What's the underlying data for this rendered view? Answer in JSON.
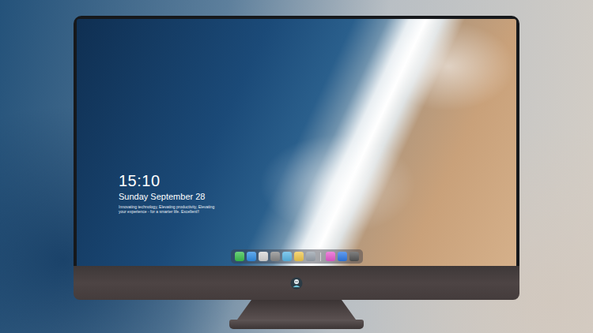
{
  "screen": {
    "clock": "15:10",
    "date": "Sunday September 28",
    "tagline": [
      "Innovating technology, Elevating productivity, Elevating",
      "your experience - for a smarter life. Excellent!!"
    ]
  },
  "dock": {
    "items": [
      {
        "kind": "app",
        "color": "#3cc24e"
      },
      {
        "kind": "app",
        "color": "#2f8fe8"
      },
      {
        "kind": "app",
        "color": "#d8d8d8"
      },
      {
        "kind": "app",
        "color": "#8a8a8a"
      },
      {
        "kind": "app",
        "color": "#5ab8e8"
      },
      {
        "kind": "app",
        "color": "#f2c94c"
      },
      {
        "kind": "app",
        "color": "#9aa3ad"
      },
      {
        "kind": "separator"
      },
      {
        "kind": "app",
        "color": "#e85bd0"
      },
      {
        "kind": "app",
        "color": "#2f7be8"
      },
      {
        "kind": "app",
        "color": "#555555"
      }
    ]
  }
}
